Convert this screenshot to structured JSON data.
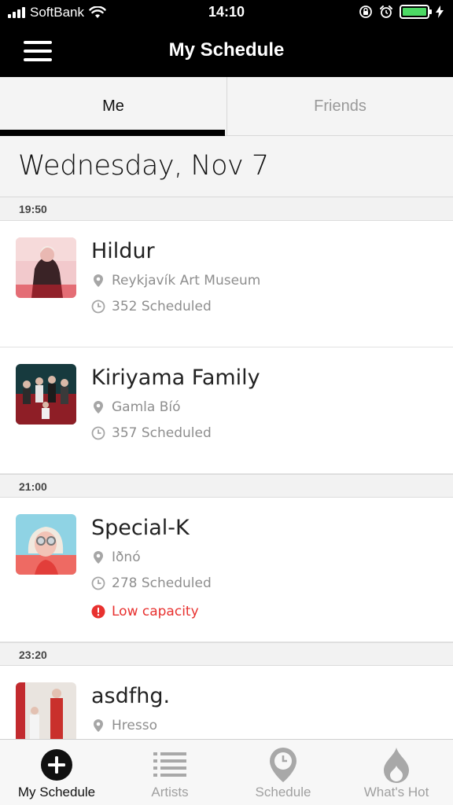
{
  "status_bar": {
    "carrier": "SoftBank",
    "time": "14:10"
  },
  "header": {
    "title": "My Schedule",
    "menu_icon": "hamburger-menu-icon"
  },
  "tabs": [
    {
      "label": "Me",
      "active": true
    },
    {
      "label": "Friends",
      "active": false
    }
  ],
  "date": "Wednesday, Nov 7",
  "groups": [
    {
      "time": "19:50",
      "events": [
        {
          "name": "Hildur",
          "venue": "Reykjavík Art Museum",
          "scheduled": "352 Scheduled"
        },
        {
          "name": "Kiriyama Family",
          "venue": "Gamla Bíó",
          "scheduled": "357 Scheduled"
        }
      ]
    },
    {
      "time": "21:00",
      "events": [
        {
          "name": "Special-K",
          "venue": "Iðnó",
          "scheduled": "278 Scheduled",
          "warning": "Low capacity"
        }
      ]
    },
    {
      "time": "23:20",
      "events": [
        {
          "name": "asdfhg.",
          "venue": "Hresso"
        }
      ]
    }
  ],
  "bottom_nav": [
    {
      "label": "My Schedule",
      "icon": "plus-circle-icon",
      "active": true
    },
    {
      "label": "Artists",
      "icon": "list-icon",
      "active": false
    },
    {
      "label": "Schedule",
      "icon": "clock-pin-icon",
      "active": false
    },
    {
      "label": "What's Hot",
      "icon": "flame-icon",
      "active": false
    }
  ],
  "colors": {
    "header_bg": "#000000",
    "warning": "#e8312f",
    "battery": "#4cd964"
  }
}
